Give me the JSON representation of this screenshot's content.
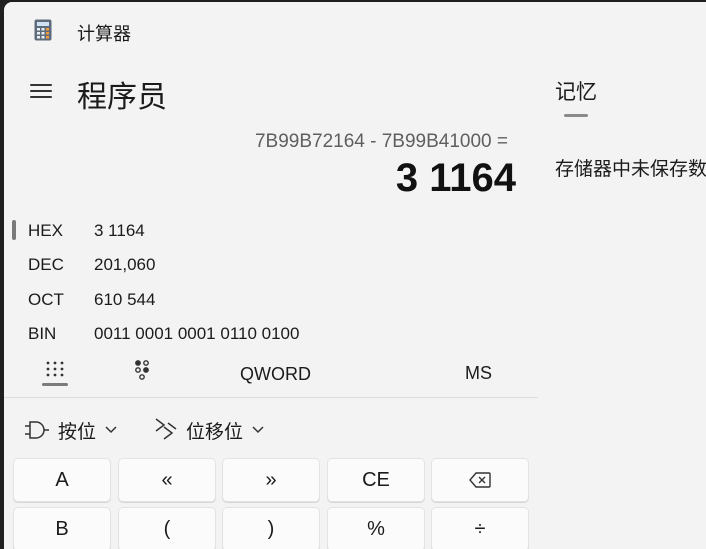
{
  "window": {
    "title": "计算器"
  },
  "header": {
    "mode_title": "程序员"
  },
  "display": {
    "expression": "7B99B72164 - 7B99B41000 =",
    "result": "3 1164"
  },
  "radix": [
    {
      "label": "HEX",
      "value": "3 1164"
    },
    {
      "label": "DEC",
      "value": "201,060"
    },
    {
      "label": "OCT",
      "value": "610 544"
    },
    {
      "label": "BIN",
      "value": "0011 0001 0001 0110 0100"
    }
  ],
  "modebar": {
    "word_size": "QWORD",
    "memory_store": "MS"
  },
  "dropdowns": {
    "bitwise": "按位",
    "bitshift": "位移位"
  },
  "keys_row1": [
    "A",
    "«",
    "»",
    "CE",
    "⌫"
  ],
  "keys_row2": [
    "B",
    "(",
    ")",
    "%",
    "÷"
  ],
  "memory": {
    "title": "记忆",
    "empty_text": "存储器中未保存数"
  }
}
